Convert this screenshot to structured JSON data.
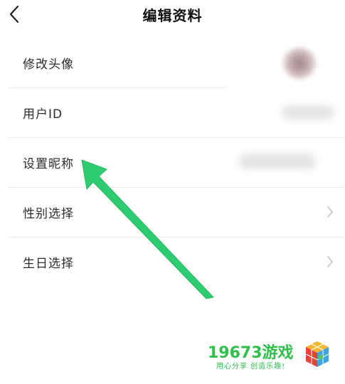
{
  "header": {
    "title": "编辑资料",
    "back_icon": "chevron-left-icon"
  },
  "menu": {
    "items": [
      {
        "label": "修改头像",
        "value_blurred": true,
        "icon": null
      },
      {
        "label": "用户ID",
        "value_blurred": true,
        "icon": null
      },
      {
        "label": "设置昵称",
        "value_blurred": true,
        "icon": null
      },
      {
        "label": "性别选择",
        "icon": "chevron-right-icon"
      },
      {
        "label": "生日选择",
        "icon": "chevron-right-icon"
      }
    ]
  },
  "annotation": {
    "type": "arrow",
    "color": "#2ecc71",
    "points_to": "设置昵称"
  },
  "watermark": {
    "brand": "19673游戏",
    "slogan": "用心分享 创造乐趣!",
    "brand_color": "#2fbf4a"
  }
}
